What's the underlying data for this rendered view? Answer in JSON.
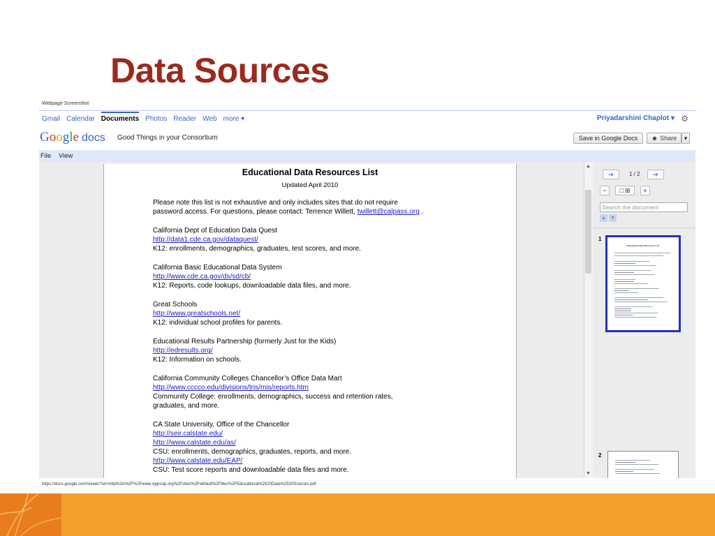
{
  "slide": {
    "title": "Data Sources",
    "screenshot_label": "Webpage Screenshot",
    "source_url": "https://docs.google.com/viewer?url=http%3A%2F%2Fwww.rpgroup.org%2Fsites%2Fdefault%2Ffiles%2FEducational%2520Data%2520Sources.pdf"
  },
  "gbar": {
    "links": [
      "Gmail",
      "Calendar",
      "Documents",
      "Photos",
      "Reader",
      "Web",
      "more ▾"
    ],
    "user": "Priyadarshini Chaplot ▾"
  },
  "docs": {
    "logo_docs": "docs",
    "doc_title": "Good Things in your Consortium",
    "save_label": "Save in Google Docs",
    "share_label": "Share",
    "share_drop": "▾"
  },
  "menu": {
    "file": "File",
    "view": "View"
  },
  "document": {
    "title": "Educational Data Resources List",
    "updated": "Updated April 2010",
    "intro1": "Please note this list is not exhaustive and only includes sites that do not require",
    "intro2_prefix": "password access. For questions, please contact: Terrence Willett, ",
    "intro2_email": "twillett@calpass.org",
    "intro2_suffix": " .",
    "entries": [
      {
        "name": "California Dept of Education Data Quest",
        "link": "http://data1.cde.ca.gov/dataquest/",
        "desc": "K12: enrollments, demographics, graduates, test scores, and more."
      },
      {
        "name": "California Basic Educational Data System",
        "link": "http://www.cde.ca.gov/ds/sd/cb/",
        "desc": "K12: Reports, code lookups, downloadable data files, and more."
      },
      {
        "name": "Great Schools",
        "link": "http://www.greatschools.net/",
        "desc": "K12: individual school profiles for parents."
      },
      {
        "name": "Educational Results Partnership (formerly Just for the Kids)",
        "link": "http://edresults.org/",
        "desc": "K12: Information on schools."
      },
      {
        "name": "California Community Colleges Chancellor’s Office Data Mart",
        "link": "http://www.cccco.edu/divisions/tris/mis/reports.htm",
        "desc": "Community College: enrollments, demographics, success and retention rates,",
        "desc2": "graduates, and more."
      },
      {
        "name": "CA State University, Office of the Chancellor",
        "link": "http://seir.calstate.edu/",
        "link2": "http://www.calstate.edu/as/",
        "desc": "CSU: enrollments, demographics, graduates, reports, and more.",
        "link3": "http://www.calstate.edu/EAP/",
        "desc3": "CSU: Test score reports and downloadable data files and more."
      }
    ]
  },
  "sidebar": {
    "page_indicator": "1 / 2",
    "search_placeholder": "Search the document",
    "thumb1": "1",
    "thumb2": "2",
    "thumb1_title": "Educational Data Resources List"
  }
}
